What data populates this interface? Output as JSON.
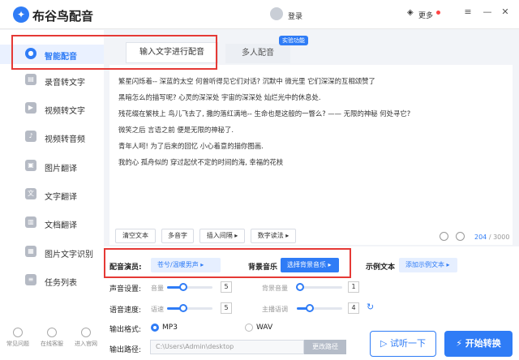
{
  "app": {
    "title": "布谷鸟配音",
    "login": "登录",
    "more": "更多"
  },
  "window": {
    "menu_icon": "≡",
    "minimize_icon": "—",
    "close_icon": "✕"
  },
  "sidebar": {
    "items": [
      {
        "label": "智能配音",
        "icon": "mic-icon",
        "active": true
      },
      {
        "label": "录音转文字",
        "icon": "record-icon"
      },
      {
        "label": "视频转文字",
        "icon": "video-icon"
      },
      {
        "label": "视频转音频",
        "icon": "audio-icon"
      },
      {
        "label": "图片翻译",
        "icon": "image-icon"
      },
      {
        "label": "文字翻译",
        "icon": "translate-icon"
      },
      {
        "label": "文档翻译",
        "icon": "document-icon"
      },
      {
        "label": "图片文字识别",
        "icon": "ocr-icon"
      },
      {
        "label": "任务列表",
        "icon": "task-icon"
      }
    ],
    "bottom": [
      {
        "label": "常见问题",
        "icon": "question-icon"
      },
      {
        "label": "在线客服",
        "icon": "headset-icon"
      },
      {
        "label": "进入官网",
        "icon": "home-icon"
      }
    ]
  },
  "tabs": {
    "text_input": "输入文字进行配音",
    "multi": "多人配音",
    "badge": "实验功能"
  },
  "editor": {
    "lines": [
      "繁星闪烁着-- 深蓝的太空 何曾听得见它们对话? 沉默中 微光里 它们深深的互相颂赞了",
      "黑暗怎么的描写呢? 心灵的深深处 宇宙的深深处 灿烂光中的休息处.",
      "残花缀在繁枝上 鸟儿飞去了, 撒的落红满地-- 生命也是这般的一瞥么? —— 无限的神秘 何处寻它?",
      "微笑之后 言语之前 便是无限的神秘了.",
      "青年人呵! 为了后来的回忆 小心着意的描你图画.",
      "我的心 孤舟似的 穿过起伏不定的时间的海, 幸福的花枝"
    ],
    "buttons": {
      "clear": "清空文本",
      "polyphone": "多音字",
      "pause": "插入间隔 ▸",
      "digits": "数字读法 ▸"
    },
    "count": "204",
    "max": "/ 3000"
  },
  "settings": {
    "voice_label": "配音演员:",
    "voice_value": "苍兮/温暖男声",
    "bgm_label": "背景音乐",
    "bgm_button": "选择背景音乐",
    "example_label": "示例文本",
    "example_button": "添加示例文本",
    "sound_label": "声音设置:",
    "volume_label": "音量",
    "volume_value": "5",
    "volume_level": 0.35,
    "bg_volume_label": "背景音量",
    "bg_volume_value": "1",
    "bg_volume_level": 0.08,
    "speed_label": "语音速度:",
    "speed_sub": "语速",
    "speed_value": "5",
    "speed_level": 0.35,
    "pitch_label": "主播语调",
    "pitch_value": "4",
    "pitch_level": 0.28,
    "format_label": "输出格式:",
    "format_mp3": "MP3",
    "format_wav": "WAV",
    "path_label": "输出路径:",
    "path_value": "C:\\Users\\Admin\\desktop",
    "path_button": "更改路径"
  },
  "actions": {
    "listen": "试听一下",
    "start": "开始转换"
  },
  "colors": {
    "accent": "#2f7cf6",
    "highlight": "#e53935"
  }
}
